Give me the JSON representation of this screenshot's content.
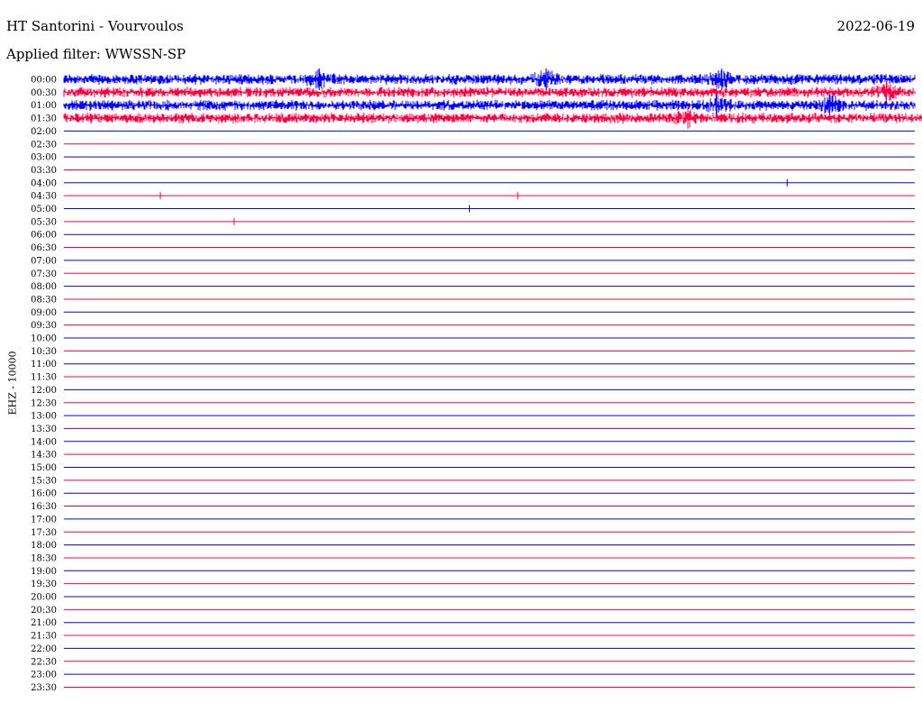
{
  "header": {
    "station": "HT Santorini - Vourvoulos",
    "filter_label": "Applied filter:",
    "filter_value": "WWSSN-SP",
    "date": "2022-06-19",
    "channel_label": "EHZ - 10000"
  },
  "colors": {
    "even_row": "#0000ff",
    "odd_row": "#ff0040",
    "background": "#ffffff"
  },
  "chart_data": {
    "type": "line",
    "title": "HT Santorini - Vourvoulos",
    "ylabel": "EHZ - 10000",
    "row_labels": [
      "00:00",
      "00:30",
      "01:00",
      "01:30",
      "02:00",
      "02:30",
      "03:00",
      "03:30",
      "04:00",
      "04:30",
      "05:00",
      "05:30",
      "06:00",
      "06:30",
      "07:00",
      "07:30",
      "08:00",
      "08:30",
      "09:00",
      "09:30",
      "10:00",
      "10:30",
      "11:00",
      "11:30",
      "12:00",
      "12:30",
      "13:00",
      "13:30",
      "14:00",
      "14:30",
      "15:00",
      "15:30",
      "16:00",
      "16:30",
      "17:00",
      "17:30",
      "18:00",
      "18:30",
      "19:00",
      "19:30",
      "20:00",
      "20:30",
      "21:00",
      "21:30",
      "22:00",
      "22:30",
      "23:00",
      "23:30"
    ],
    "minutes_per_row": 30,
    "series": [
      {
        "row": "00:00",
        "activity": "noise",
        "events_at_minute": [
          9,
          17,
          23.2
        ]
      },
      {
        "row": "00:30",
        "activity": "noise",
        "events_at_minute": [
          29
        ]
      },
      {
        "row": "01:00",
        "activity": "noise",
        "events_at_minute": [
          23,
          27
        ]
      },
      {
        "row": "01:30",
        "activity": "noise",
        "events_at_minute": [
          22,
          35.6
        ],
        "trace_end_minute": 36
      },
      {
        "row": "04:00",
        "activity": "blip",
        "events_at_minute": [
          25.5
        ]
      },
      {
        "row": "04:30",
        "activity": "blip",
        "events_at_minute": [
          3.4,
          16
        ]
      },
      {
        "row": "05:00",
        "activity": "blip",
        "events_at_minute": [
          14.3
        ]
      },
      {
        "row": "05:30",
        "activity": "blip",
        "events_at_minute": [
          6
        ]
      }
    ],
    "saturated_band_minutes": [
      33.6,
      36.5
    ],
    "grid": true,
    "legend": "none"
  }
}
